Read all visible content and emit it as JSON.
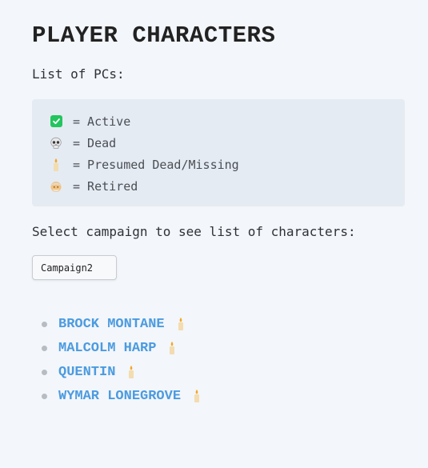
{
  "page": {
    "title": "PLAYER CHARACTERS",
    "intro": "List of PCs:"
  },
  "legend": {
    "items": [
      {
        "icon": "check-icon",
        "text": "= Active"
      },
      {
        "icon": "skull-icon",
        "text": "= Dead"
      },
      {
        "icon": "candle-icon",
        "text": "= Presumed Dead/Missing"
      },
      {
        "icon": "elder-icon",
        "text": "= Retired"
      }
    ]
  },
  "selector": {
    "prompt": "Select campaign to see list of characters:",
    "selected": "Campaign2"
  },
  "characters": [
    {
      "name": "BROCK MONTANE",
      "status": "candle-icon"
    },
    {
      "name": "MALCOLM HARP",
      "status": "candle-icon"
    },
    {
      "name": "QUENTIN",
      "status": "candle-icon"
    },
    {
      "name": "WYMAR LONEGROVE",
      "status": "candle-icon"
    }
  ],
  "colors": {
    "background": "#f3f6fa",
    "legend_bg": "#e5ebf2",
    "link": "#4b9be0",
    "active_green": "#23c55e"
  }
}
